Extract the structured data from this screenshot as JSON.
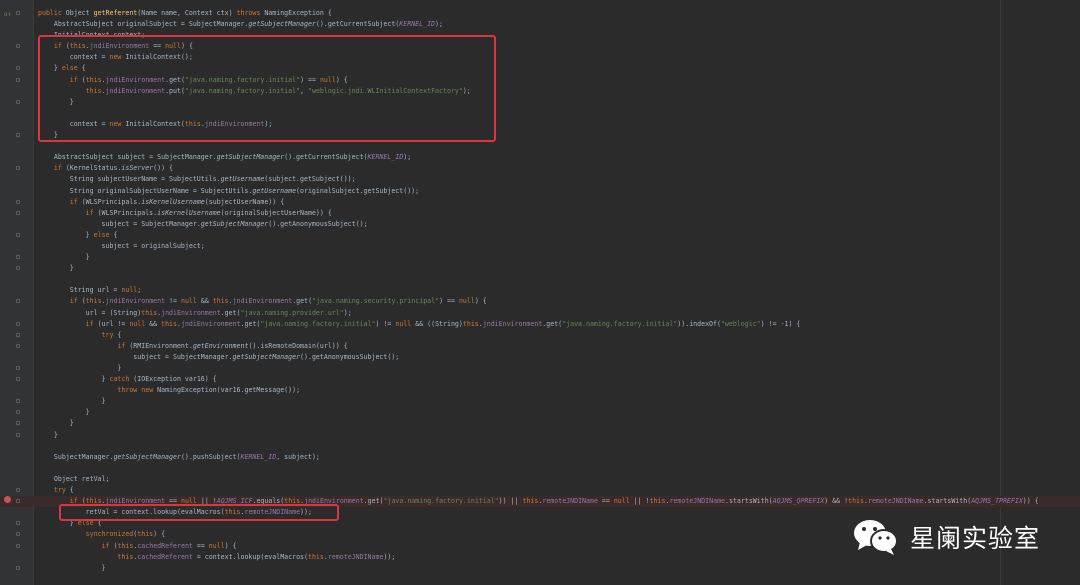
{
  "editor": {
    "lines": [
      {
        "text": "public Object getReferent(Name name, Context ctx) throws NamingException {"
      },
      {
        "text": "    AbstractSubject originalSubject = SubjectManager.getSubjectManager().getCurrentSubject(KERNEL_ID);"
      },
      {
        "text": "    InitialContext context;"
      },
      {
        "text": "    if (this.jndiEnvironment == null) {"
      },
      {
        "text": "        context = new InitialContext();"
      },
      {
        "text": "    } else {"
      },
      {
        "text": "        if (this.jndiEnvironment.get(\"java.naming.factory.initial\") == null) {"
      },
      {
        "text": "            this.jndiEnvironment.put(\"java.naming.factory.initial\", \"weblogic.jndi.WLInitialContextFactory\");"
      },
      {
        "text": "        }"
      },
      {
        "text": ""
      },
      {
        "text": "        context = new InitialContext(this.jndiEnvironment);"
      },
      {
        "text": "    }"
      },
      {
        "text": ""
      },
      {
        "text": "    AbstractSubject subject = SubjectManager.getSubjectManager().getCurrentSubject(KERNEL_ID);"
      },
      {
        "text": "    if (KernelStatus.isServer()) {"
      },
      {
        "text": "        String subjectUserName = SubjectUtils.getUsername(subject.getSubject());"
      },
      {
        "text": "        String originalSubjectUserName = SubjectUtils.getUsername(originalSubject.getSubject());"
      },
      {
        "text": "        if (WLSPrincipals.isKernelUsername(subjectUserName)) {"
      },
      {
        "text": "            if (WLSPrincipals.isKernelUsername(originalSubjectUserName)) {"
      },
      {
        "text": "                subject = SubjectManager.getSubjectManager().getAnonymousSubject();"
      },
      {
        "text": "            } else {"
      },
      {
        "text": "                subject = originalSubject;"
      },
      {
        "text": "            }"
      },
      {
        "text": "        }"
      },
      {
        "text": ""
      },
      {
        "text": "        String url = null;"
      },
      {
        "text": "        if (this.jndiEnvironment != null && this.jndiEnvironment.get(\"java.naming.security.principal\") == null) {"
      },
      {
        "text": "            url = (String)this.jndiEnvironment.get(\"java.naming.provider.url\");"
      },
      {
        "text": "            if (url != null && this.jndiEnvironment.get(\"java.naming.factory.initial\") != null && ((String)this.jndiEnvironment.get(\"java.naming.factory.initial\")).indexOf(\"weblogic\") != -1) {"
      },
      {
        "text": "                try {"
      },
      {
        "text": "                    if (RMIEnvironment.getEnvironment().isRemoteDomain(url)) {"
      },
      {
        "text": "                        subject = SubjectManager.getSubjectManager().getAnonymousSubject();"
      },
      {
        "text": "                    }"
      },
      {
        "text": "                } catch (IOException var16) {"
      },
      {
        "text": "                    throw new NamingException(var16.getMessage());"
      },
      {
        "text": "                }"
      },
      {
        "text": "            }"
      },
      {
        "text": "        }"
      },
      {
        "text": "    }"
      },
      {
        "text": ""
      },
      {
        "text": "    SubjectManager.getSubjectManager().pushSubject(KERNEL_ID, subject);"
      },
      {
        "text": ""
      },
      {
        "text": "    Object retVal;"
      },
      {
        "text": "    try {"
      },
      {
        "text": "        if (this.jndiEnvironment == null || !AQJMS_ICF.equals(this.jndiEnvironment.get(\"java.naming.factory.initial\")) || this.remoteJNDIName == null || !this.remoteJNDIName.startsWith(AQJMS_QPREFIX) && !this.remoteJNDIName.startsWith(AQJMS_TPREFIX)) {"
      },
      {
        "text": "            retVal = context.lookup(evalMacros(this.remoteJNDIName));"
      },
      {
        "text": "        } else {"
      },
      {
        "text": "            synchronized(this) {"
      },
      {
        "text": "                if (this.cachedReferent == null) {"
      },
      {
        "text": "                    this.cachedReferent = context.lookup(evalMacros(this.remoteJNDIName));"
      },
      {
        "text": "                }"
      }
    ]
  },
  "watermark": {
    "label": "星阑实验室",
    "icon": "wechat-icon"
  },
  "colors": {
    "background": "#2b2b2b",
    "keyword": "#cc7832",
    "string": "#6a8759",
    "field": "#9876aa",
    "method": "#ffc66d",
    "highlight_box": "#d9363e"
  }
}
